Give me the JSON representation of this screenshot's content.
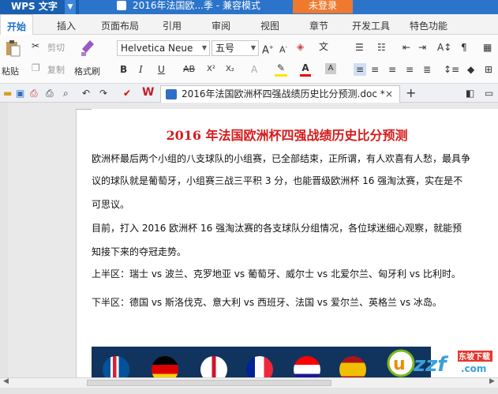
{
  "titlebar": {
    "app_name": "WPS 文字",
    "window_title": "2016年法国欧...季 - 兼容模式",
    "login_label": "未登录"
  },
  "menu": {
    "items": [
      "开始",
      "插入",
      "页面布局",
      "引用",
      "审阅",
      "视图",
      "章节",
      "开发工具",
      "特色功能"
    ]
  },
  "ribbon": {
    "paste_label": "粘贴",
    "cut_label": "剪切",
    "copy_label": "复制",
    "format_painter_label": "格式刷",
    "font_name": "Helvetica Neue",
    "font_size": "五号"
  },
  "tab": {
    "doc_name": "2016年法国欧洲杯四强战绩历史比分预测.doc *",
    "close_glyph": "×",
    "new_tab_glyph": "+"
  },
  "document": {
    "title": "2016 年法国欧洲杯四强战绩历史比分预测",
    "lines": [
      "欧洲杯最后两个小组的八支球队的小组赛，已全部结束，正所谓，有人欢喜有人愁，最具争",
      "议的球队就是葡萄牙，小组赛三战三平积 3 分，也能晋级欧洲杯 16 强淘汰赛，实在是不",
      "可思议。",
      "目前，打入 2016 欧洲杯 16 强淘汰赛的各支球队分组情况，各位球迷细心观察，就能预",
      "知接下来的夺冠走势。",
      "上半区：瑞士 vs 波兰、克罗地亚 vs 葡萄牙、威尔士 vs 北爱尔兰、匈牙利 vs 比利时。",
      "下半区：德国 vs 斯洛伐克、意大利 vs 西班牙、法国 vs 爱尔兰、英格兰 vs 冰岛。"
    ]
  },
  "watermark": {
    "brand": "uzzf",
    "sub": "东坡下载",
    "url_suffix": ".com"
  },
  "colors": {
    "title_red": "#d61b1b",
    "accent_blue": "#2b74c9",
    "login_orange": "#ef7a2e"
  }
}
